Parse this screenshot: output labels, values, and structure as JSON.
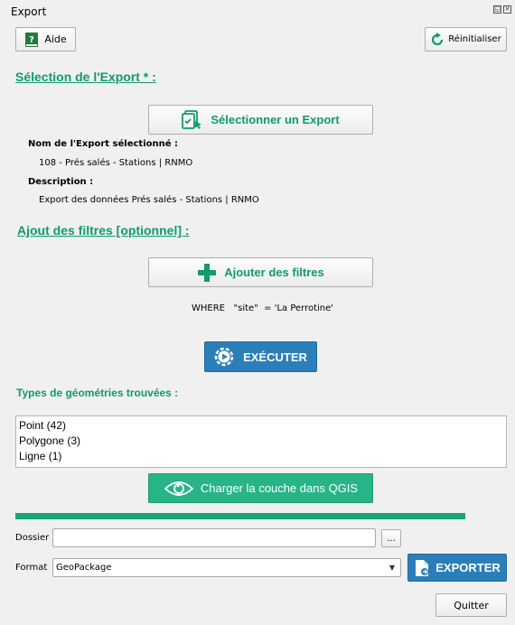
{
  "window": {
    "title": "Export"
  },
  "toolbar": {
    "help_label": "Aide",
    "reset_label": "Réinitialiser"
  },
  "selection": {
    "title": "Sélection de l'Export * :",
    "select_button": "Sélectionner un Export",
    "name_label": "Nom de l'Export sélectionné :",
    "name_value": "108 - Prés salés - Stations | RNMO",
    "description_label": "Description :",
    "description_value": "Export des données Prés salés - Stations | RNMO"
  },
  "filters": {
    "title": "Ajout des filtres [optionnel] :",
    "add_button": "Ajouter des filtres",
    "where_clause": "WHERE   \"site\"  = 'La Perrotine'"
  },
  "execute": {
    "label": "EXÉCUTER"
  },
  "geometries": {
    "title": "Types de géométries trouvées :",
    "items": [
      "Point (42)",
      "Polygone (3)",
      "Ligne (1)"
    ],
    "load_button": "Charger la couche dans QGIS"
  },
  "progress": {
    "value": 1.0
  },
  "output": {
    "folder_label": "Dossier",
    "folder_value": "",
    "browse_label": "...",
    "format_label": "Format",
    "format_value": "GeoPackage",
    "export_label": "EXPORTER"
  },
  "footer": {
    "quit_label": "Quitter"
  },
  "colors": {
    "accent": "#0f9b6b",
    "execute_bg": "#2b7fb8",
    "load_bg": "#27b486"
  }
}
